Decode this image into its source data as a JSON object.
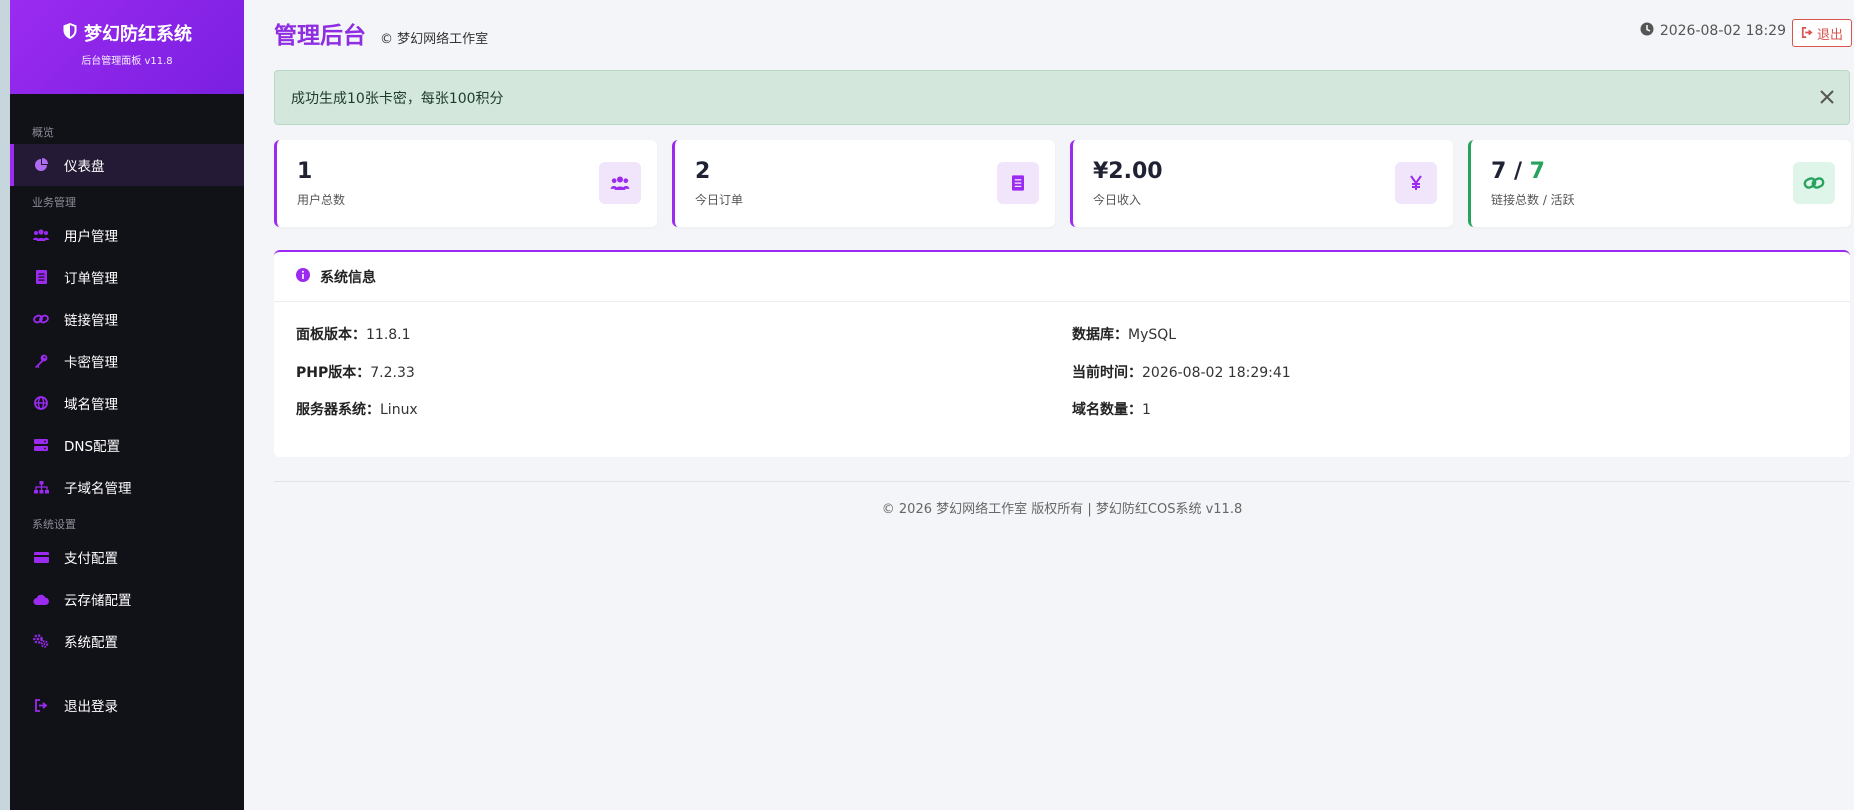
{
  "brand": {
    "title": "梦幻防红系统",
    "subtitle": "后台管理面板 v11.8"
  },
  "sidebar": {
    "sections": [
      {
        "label": "概览"
      },
      {
        "label": "业务管理"
      },
      {
        "label": "系统设置"
      }
    ],
    "items": [
      {
        "label": "仪表盘",
        "icon": "pie-chart-icon"
      },
      {
        "label": "用户管理",
        "icon": "users-icon"
      },
      {
        "label": "订单管理",
        "icon": "receipt-icon"
      },
      {
        "label": "链接管理",
        "icon": "link-icon"
      },
      {
        "label": "卡密管理",
        "icon": "key-icon"
      },
      {
        "label": "域名管理",
        "icon": "globe-icon"
      },
      {
        "label": "DNS配置",
        "icon": "server-icon"
      },
      {
        "label": "子域名管理",
        "icon": "sitemap-icon"
      },
      {
        "label": "支付配置",
        "icon": "credit-card-icon"
      },
      {
        "label": "云存储配置",
        "icon": "cloud-icon"
      },
      {
        "label": "系统配置",
        "icon": "gears-icon"
      },
      {
        "label": "退出登录",
        "icon": "sign-out-icon"
      }
    ]
  },
  "header": {
    "title": "管理后台",
    "subtitle": "© 梦幻网络工作室",
    "datetime": "2026-08-02 18:29",
    "logout_label": "退出"
  },
  "alert": {
    "message": "成功生成10张卡密，每张100积分"
  },
  "stats": [
    {
      "value": "1",
      "label": "用户总数",
      "icon": "users-icon"
    },
    {
      "value": "2",
      "label": "今日订单",
      "icon": "receipt-icon"
    },
    {
      "value": "¥2.00",
      "label": "今日收入",
      "icon": "yen-icon"
    },
    {
      "value_total": "7 / ",
      "value_active": "7",
      "label": "链接总数 / 活跃",
      "icon": "link-icon"
    }
  ],
  "system_info": {
    "title": "系统信息",
    "rows": [
      {
        "key": "面板版本：",
        "value": "11.8.1"
      },
      {
        "key": "PHP版本：",
        "value": "7.2.33"
      },
      {
        "key": "服务器系统：",
        "value": "Linux"
      },
      {
        "key": "数据库：",
        "value": "MySQL"
      },
      {
        "key": "当前时间：",
        "value": "2026-08-02 18:29:41"
      },
      {
        "key": "域名数量：",
        "value": "1"
      }
    ]
  },
  "footer": {
    "text": "© 2026 梦幻网络工作室 版权所有 | 梦幻防红COS系统 v11.8"
  },
  "colors": {
    "accent": "#9b2bf0",
    "sidebar_bg": "#111118",
    "success_green": "#27a35f",
    "danger": "#d9534f",
    "alert_bg": "#d3e7dc"
  }
}
